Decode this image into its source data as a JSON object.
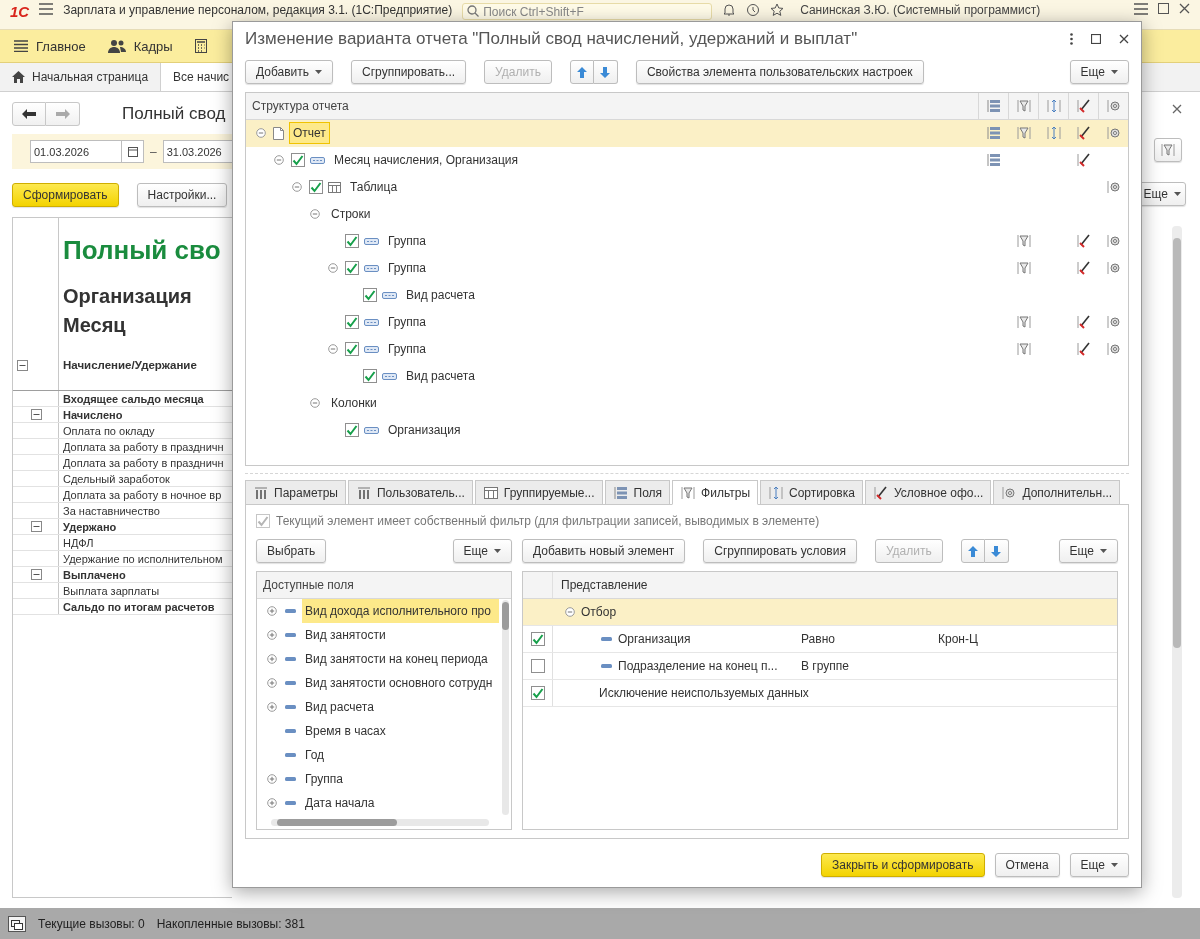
{
  "app": {
    "logo": "1С",
    "title": "Зарплата и управление персоналом, редакция 3.1. (1С:Предприятие)",
    "search": {
      "placeholder": "Поиск Ctrl+Shift+F"
    },
    "user": "Санинская З.Ю. (Системный программист)"
  },
  "sections": [
    {
      "label": "Главное"
    },
    {
      "label": "Кадры"
    }
  ],
  "open_tabs": [
    {
      "label": "Начальная страница",
      "selected": false
    },
    {
      "label": "Все начис",
      "selected": true
    }
  ],
  "report": {
    "title": "Полный свод",
    "date_from": "01.03.2026",
    "date_separator": "–",
    "date_to": "31.03.2026",
    "generate_button": "Сформировать",
    "settings_button": "Настройки...",
    "more_button": "Еще",
    "heading": "Полный сво",
    "subheadings": [
      "Организация",
      "Месяц"
    ],
    "column_header": "Начисление/Удержание",
    "rows": [
      {
        "kind": "total",
        "text": "Входящее сальдо месяца"
      },
      {
        "kind": "group",
        "text": "Начислено"
      },
      {
        "kind": "item",
        "text": "Оплата по окладу"
      },
      {
        "kind": "item",
        "text": "Доплата за работу в праздничн"
      },
      {
        "kind": "item",
        "text": "Доплата за работу в праздничн"
      },
      {
        "kind": "item",
        "text": "Сдельный заработок"
      },
      {
        "kind": "item",
        "text": "Доплата за работу в ночное вр"
      },
      {
        "kind": "item",
        "text": "За наставничество"
      },
      {
        "kind": "group",
        "text": "Удержано"
      },
      {
        "kind": "item",
        "text": "НДФЛ"
      },
      {
        "kind": "item",
        "text": "Удержание по исполнительном"
      },
      {
        "kind": "group",
        "text": "Выплачено"
      },
      {
        "kind": "item",
        "text": "Выплата зарплаты"
      },
      {
        "kind": "total",
        "text": "Сальдо по итогам расчетов"
      }
    ]
  },
  "dialog": {
    "title": "Изменение варианта отчета \"Полный свод начислений, удержаний и выплат\"",
    "toolbar": [
      {
        "label": "Добавить",
        "kind": "menu",
        "disabled": false
      },
      {
        "label": "Сгруппировать...",
        "kind": "plain",
        "disabled": false
      },
      {
        "label": "Удалить",
        "kind": "plain",
        "disabled": true
      },
      {
        "kind": "arrows"
      },
      {
        "label": "Свойства элемента пользовательских настроек",
        "kind": "plain",
        "disabled": false
      },
      {
        "label": "Еще",
        "kind": "more",
        "disabled": false
      }
    ],
    "structure": {
      "header": "Структура отчета",
      "tree": [
        {
          "label": "Отчет",
          "kind": "report",
          "selected": true,
          "expanded": true,
          "icons": [
            true,
            true,
            true,
            true,
            true
          ],
          "children": [
            {
              "label": "Месяц начисления, Организация",
              "kind": "grouping",
              "checked": true,
              "selected": false,
              "expanded": true,
              "icons": [
                true,
                false,
                false,
                true,
                false
              ],
              "children": [
                {
                  "label": "Таблица",
                  "kind": "table",
                  "checked": true,
                  "selected": false,
                  "expanded": true,
                  "icons": [
                    false,
                    false,
                    false,
                    false,
                    true
                  ],
                  "children": [
                    {
                      "label": "Строки",
                      "selected": false,
                      "expanded": true,
                      "icons": [
                        false,
                        false,
                        false,
                        false,
                        false
                      ],
                      "children": [
                        {
                          "label": "Группа",
                          "kind": "grouping",
                          "checked": true,
                          "selected": false,
                          "icons": [
                            false,
                            true,
                            false,
                            true,
                            true
                          ]
                        },
                        {
                          "label": "Группа",
                          "kind": "grouping",
                          "checked": true,
                          "selected": false,
                          "expanded": true,
                          "icons": [
                            false,
                            true,
                            false,
                            true,
                            true
                          ],
                          "children": [
                            {
                              "label": "Вид расчета",
                              "kind": "grouping",
                              "checked": true,
                              "selected": false,
                              "icons": [
                                false,
                                false,
                                false,
                                false,
                                false
                              ]
                            }
                          ]
                        },
                        {
                          "label": "Группа",
                          "kind": "grouping",
                          "checked": true,
                          "selected": false,
                          "icons": [
                            false,
                            true,
                            false,
                            true,
                            true
                          ]
                        },
                        {
                          "label": "Группа",
                          "kind": "grouping",
                          "checked": true,
                          "selected": false,
                          "expanded": true,
                          "icons": [
                            false,
                            true,
                            false,
                            true,
                            true
                          ],
                          "children": [
                            {
                              "label": "Вид расчета",
                              "kind": "grouping",
                              "checked": true,
                              "selected": false,
                              "icons": [
                                false,
                                false,
                                false,
                                false,
                                false
                              ]
                            }
                          ]
                        }
                      ]
                    },
                    {
                      "label": "Колонки",
                      "selected": false,
                      "expanded": true,
                      "icons": [
                        false,
                        false,
                        false,
                        false,
                        false
                      ],
                      "children": [
                        {
                          "label": "Организация",
                          "kind": "grouping",
                          "checked": true,
                          "selected": false,
                          "icons": [
                            false,
                            false,
                            false,
                            false,
                            false
                          ]
                        }
                      ]
                    }
                  ]
                }
              ]
            }
          ]
        }
      ]
    },
    "tabs": [
      {
        "label": "Параметры",
        "selected": false
      },
      {
        "label": "Пользователь...",
        "selected": false
      },
      {
        "label": "Группируемые...",
        "selected": false
      },
      {
        "label": "Поля",
        "selected": false
      },
      {
        "label": "Фильтры",
        "selected": true
      },
      {
        "label": "Сортировка",
        "selected": false
      },
      {
        "label": "Условное офо...",
        "selected": false
      },
      {
        "label": "Дополнительн...",
        "selected": false
      }
    ],
    "filters": {
      "own_filter": {
        "label": "Текущий элемент имеет собственный фильтр (для фильтрации записей, выводимых в элементе)",
        "checked": true,
        "disabled": true
      },
      "left_buttons": [
        {
          "label": "Выбрать",
          "kind": "plain",
          "disabled": false
        },
        {
          "label": "Еще",
          "kind": "more",
          "disabled": false
        }
      ],
      "fields_header": "Доступные поля",
      "fields": [
        {
          "label": "Вид дохода исполнительного про",
          "expandable": true,
          "selected": true
        },
        {
          "label": "Вид занятости",
          "expandable": true,
          "selected": false
        },
        {
          "label": "Вид занятости на конец периода",
          "expandable": true,
          "selected": false
        },
        {
          "label": "Вид занятости основного сотрудн",
          "expandable": true,
          "selected": false
        },
        {
          "label": "Вид расчета",
          "expandable": true,
          "selected": false
        },
        {
          "label": "Время в часах",
          "expandable": false,
          "selected": false
        },
        {
          "label": "Год",
          "expandable": false,
          "selected": false
        },
        {
          "label": "Группа",
          "expandable": true,
          "selected": false
        },
        {
          "label": "Дата начала",
          "expandable": true,
          "selected": false
        }
      ],
      "right_buttons": [
        {
          "label": "Добавить новый элемент",
          "kind": "plain",
          "disabled": false
        },
        {
          "label": "Сгруппировать условия",
          "kind": "plain",
          "disabled": false
        },
        {
          "label": "Удалить",
          "kind": "plain",
          "disabled": true
        },
        {
          "kind": "arrows"
        },
        {
          "label": "Еще",
          "kind": "more",
          "disabled": false
        }
      ],
      "table": {
        "header": "Представление",
        "rows": [
          {
            "kind": "group",
            "label": "Отбор",
            "expanded": true,
            "selected": true
          },
          {
            "kind": "condition",
            "checked": true,
            "label": "Организация",
            "operator": "Равно",
            "value": "Крон-Ц",
            "selected": false
          },
          {
            "kind": "condition",
            "checked": false,
            "label": "Подразделение на конец п...",
            "operator": "В группе",
            "selected": false
          },
          {
            "kind": "option",
            "checked": true,
            "label": "Исключение неиспользуемых данных",
            "selected": false
          }
        ]
      }
    },
    "footer": [
      {
        "label": "Закрыть и сформировать",
        "kind": "primary"
      },
      {
        "label": "Отмена",
        "kind": "plain"
      },
      {
        "label": "Еще",
        "kind": "more"
      }
    ]
  },
  "status_bar": {
    "current": "Текущие вызовы: 0",
    "accumulated": "Накопленные вызовы: 381"
  }
}
